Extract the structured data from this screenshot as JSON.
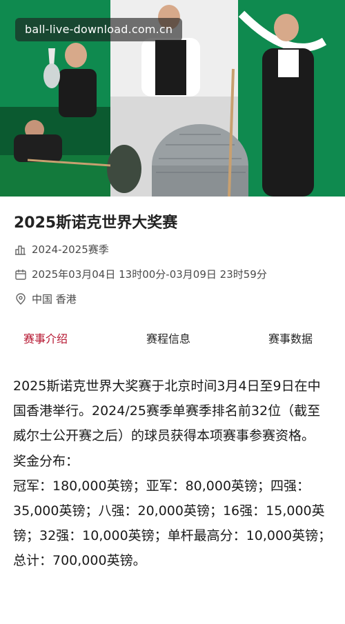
{
  "watermark": {
    "text": "ball-live-download.com.cn"
  },
  "event": {
    "title": "2025斯诺克世界大奖赛",
    "season": "2024-2025赛季",
    "datetime": "2025年03月04日 13时00分-03月09日 23时59分",
    "location": "中国 香港"
  },
  "icons": {
    "season": "bar-chart-icon",
    "datetime": "calendar-icon",
    "location": "location-pin-icon"
  },
  "tabs": [
    {
      "label": "赛事介绍",
      "active": true
    },
    {
      "label": "赛程信息",
      "active": false
    },
    {
      "label": "赛事数据",
      "active": false
    }
  ],
  "colors": {
    "accent": "#b5142f",
    "banner_green": "#0f8a4f"
  },
  "content": {
    "intro": "2025斯诺克世界大奖赛于北京时间3月4日至9日在中国香港举行。2024/25赛季单赛季排名前32位（截至威尔士公开赛之后）的球员获得本项赛事参赛资格。",
    "prize_heading": "奖金分布：",
    "prize_text": "冠军：180,000英镑；亚军：80,000英镑；四强：35,000英镑；八强：20,000英镑；16强：15,000英镑；32强：10,000英镑；单杆最高分：10,000英镑；总计：700,000英镑。"
  }
}
